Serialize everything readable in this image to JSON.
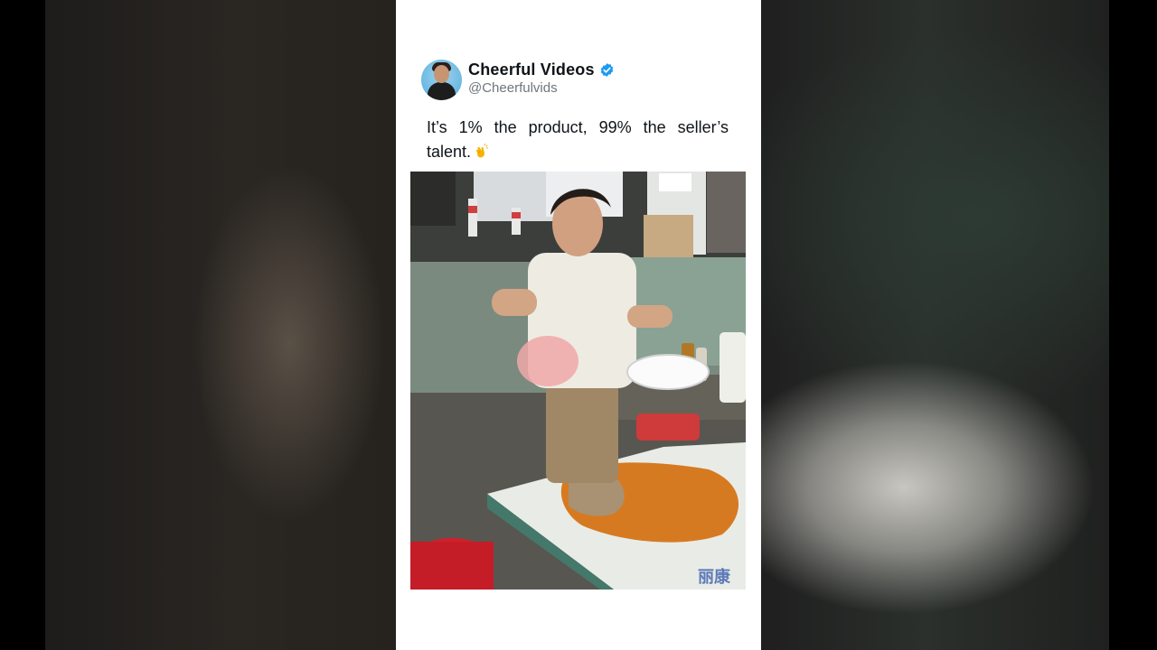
{
  "post": {
    "author": {
      "display_name": "Cheerful Videos",
      "handle": "@Cheerfulvids",
      "verified": true,
      "avatar_icon": "avatar-icon"
    },
    "text": "It’s 1% the product, 99% the seller’s talent.",
    "emoji_icon": "clapping-hands-icon",
    "media_icon": "video-thumbnail",
    "media_caption": "丽康"
  },
  "colors": {
    "verified_badge": "#1d9bf0",
    "name": "#0f1419",
    "handle": "#6e767d",
    "card_bg": "#ffffff"
  }
}
